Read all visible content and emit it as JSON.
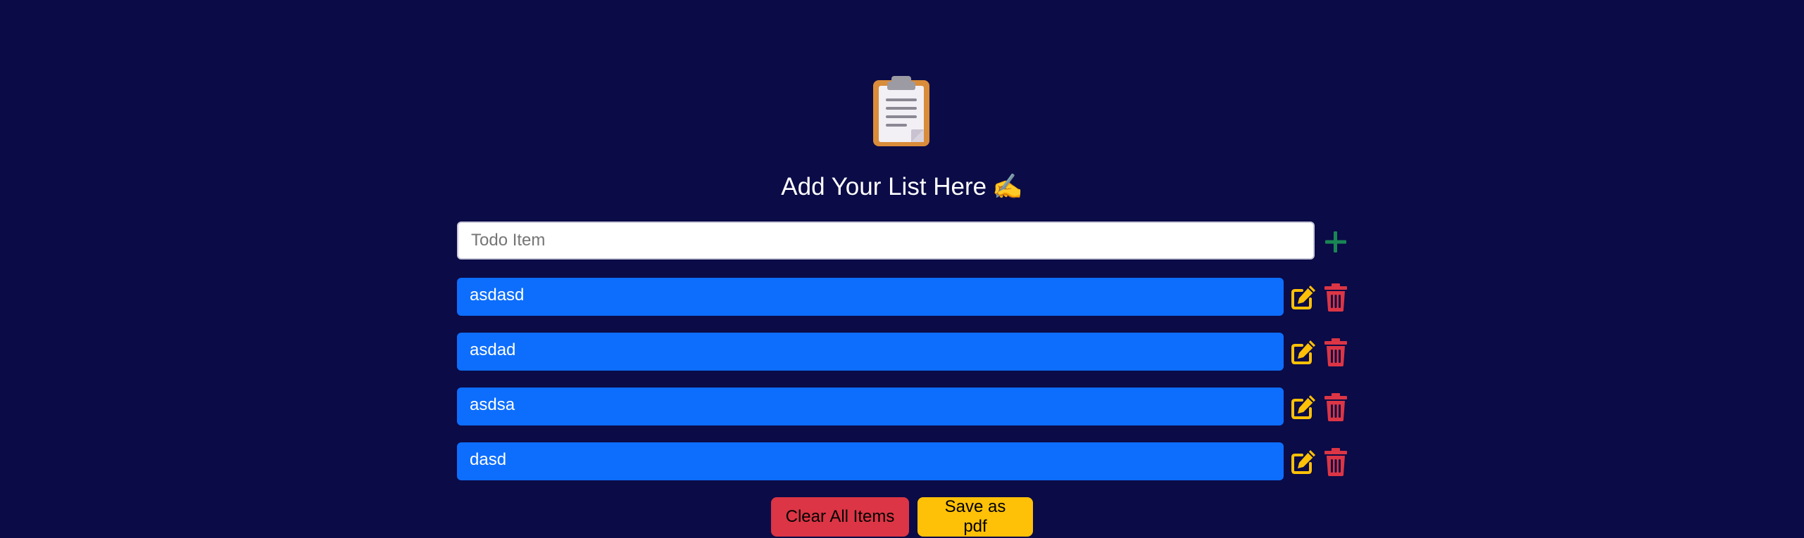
{
  "header": {
    "logo_icon": "clipboard-icon",
    "title": "Add Your List Here",
    "title_emoji": "✍️"
  },
  "input": {
    "placeholder": "Todo Item",
    "value": "",
    "add_icon": "plus-icon"
  },
  "items": [
    {
      "label": "asdasd",
      "edit_icon": "edit-icon",
      "delete_icon": "trash-icon"
    },
    {
      "label": "asdad",
      "edit_icon": "edit-icon",
      "delete_icon": "trash-icon"
    },
    {
      "label": "asdsa",
      "edit_icon": "edit-icon",
      "delete_icon": "trash-icon"
    },
    {
      "label": "dasd",
      "edit_icon": "edit-icon",
      "delete_icon": "trash-icon"
    }
  ],
  "actions": {
    "clear_label": "Clear All Items",
    "save_label": "Save as pdf"
  },
  "colors": {
    "background": "#0b0b47",
    "item": "#0d6efd",
    "add": "#198754",
    "edit": "#ffc107",
    "delete": "#dc3545"
  }
}
